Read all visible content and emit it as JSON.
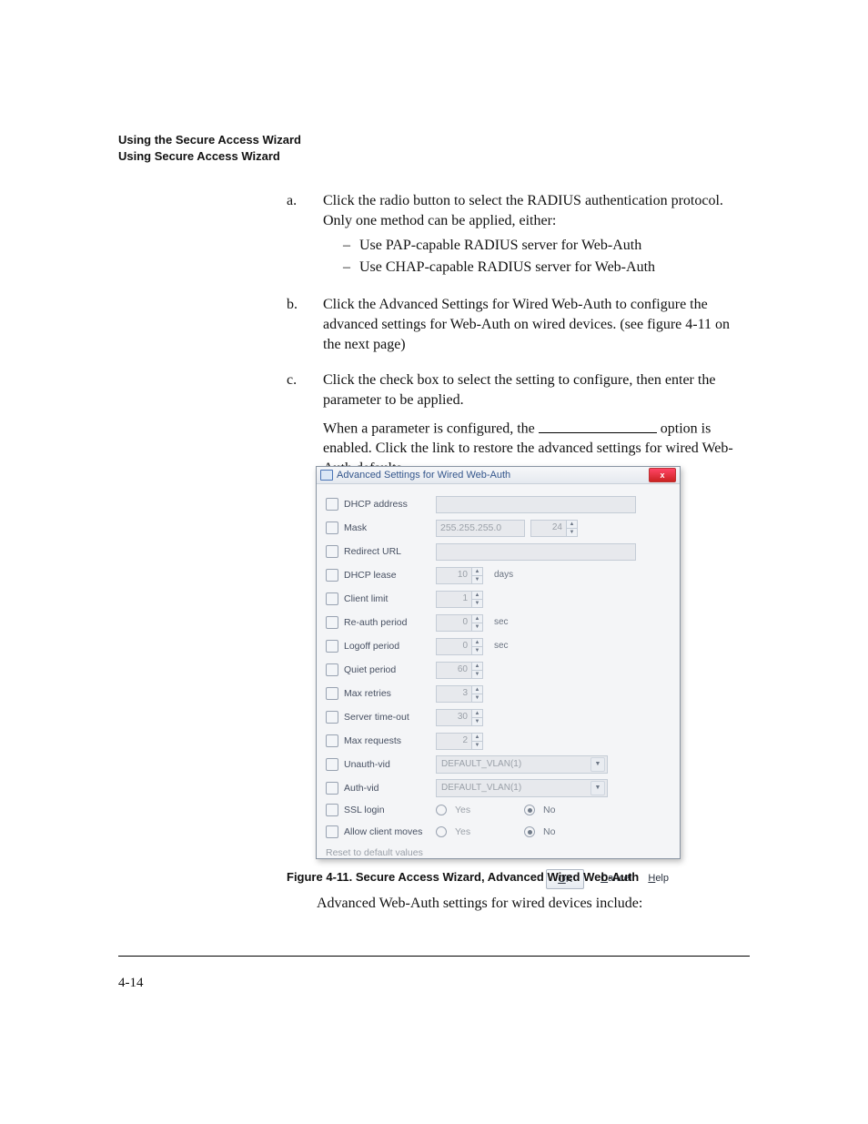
{
  "header": {
    "l1": "Using the Secure Access Wizard",
    "l2": "Using Secure Access Wizard"
  },
  "steps": {
    "a": {
      "marker": "a.",
      "text": "Click the radio button to select the RADIUS authentication protocol. Only one method can be applied, either:",
      "opt1": "Use PAP-capable RADIUS server for Web-Auth",
      "opt2": "Use CHAP-capable RADIUS server for Web-Auth"
    },
    "b": {
      "marker": "b.",
      "text": "Click the Advanced Settings for Wired Web-Auth to configure the advanced settings for Web-Auth on wired devices. (see figure 4-11 on the next page)"
    },
    "c": {
      "marker": "c.",
      "text": "Click the check box to select the setting to configure, then enter the parameter to be applied.",
      "para_before": "When a parameter is configured, the ",
      "para_after": " option is enabled. Click the link to restore the advanced settings for wired Web-Auth defaults."
    }
  },
  "dialog": {
    "title": "Advanced Settings for Wired Web-Auth",
    "close": "x",
    "rows": {
      "dhcp_addr": {
        "label": "DHCP address"
      },
      "mask": {
        "label": "Mask",
        "ip": "255.255.255.0",
        "spin": "24"
      },
      "redirect": {
        "label": "Redirect URL"
      },
      "dhcp_lease": {
        "label": "DHCP lease",
        "spin": "10",
        "unit": "days"
      },
      "client_limit": {
        "label": "Client limit",
        "spin": "1"
      },
      "reauth": {
        "label": "Re-auth period",
        "spin": "0",
        "unit": "sec"
      },
      "logoff": {
        "label": "Logoff period",
        "spin": "0",
        "unit": "sec"
      },
      "quiet": {
        "label": "Quiet period",
        "spin": "60"
      },
      "retries": {
        "label": "Max retries",
        "spin": "3"
      },
      "srvto": {
        "label": "Server time-out",
        "spin": "30"
      },
      "maxreq": {
        "label": "Max requests",
        "spin": "2"
      },
      "unauth": {
        "label": "Unauth-vid",
        "select": "DEFAULT_VLAN(1)"
      },
      "auth": {
        "label": "Auth-vid",
        "select": "DEFAULT_VLAN(1)"
      },
      "ssl": {
        "label": "SSL login",
        "yes": "Yes",
        "no": "No"
      },
      "moves": {
        "label": "Allow client moves",
        "yes": "Yes",
        "no": "No"
      }
    },
    "reset": "Reset to default values",
    "buttons": {
      "ok_u": "O",
      "ok": "K",
      "cancel_u": "C",
      "cancel": "ancel",
      "help_u": "H",
      "help": "elp"
    }
  },
  "figcap": "Figure 4-11. Secure Access Wizard, Advanced Wired Web-Auth",
  "closing": "Advanced Web-Auth settings for wired devices include:",
  "pagenum": "4-14"
}
